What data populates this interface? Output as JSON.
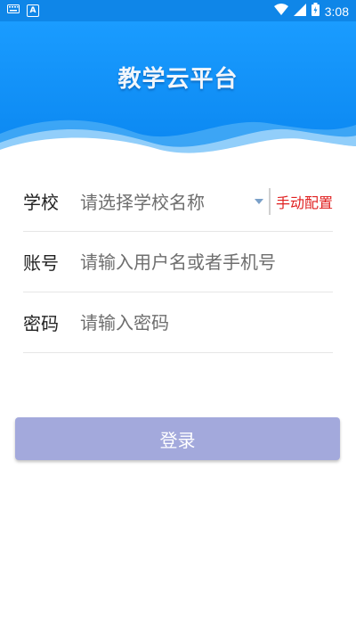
{
  "status_bar": {
    "time": "3:08",
    "icons": [
      "keyboard-icon",
      "a-icon",
      "wifi-icon",
      "signal-icon",
      "battery-icon"
    ]
  },
  "header": {
    "title": "教学云平台"
  },
  "form": {
    "school": {
      "label": "学校",
      "placeholder": "请选择学校名称",
      "manual_config": "手动配置"
    },
    "account": {
      "label": "账号",
      "placeholder": "请输入用户名或者手机号"
    },
    "password": {
      "label": "密码",
      "placeholder": "请输入密码"
    }
  },
  "login_button": "登录",
  "colors": {
    "header": "#0a86f0",
    "manual_config": "#e02020",
    "login_button": "#a3a9dc"
  }
}
